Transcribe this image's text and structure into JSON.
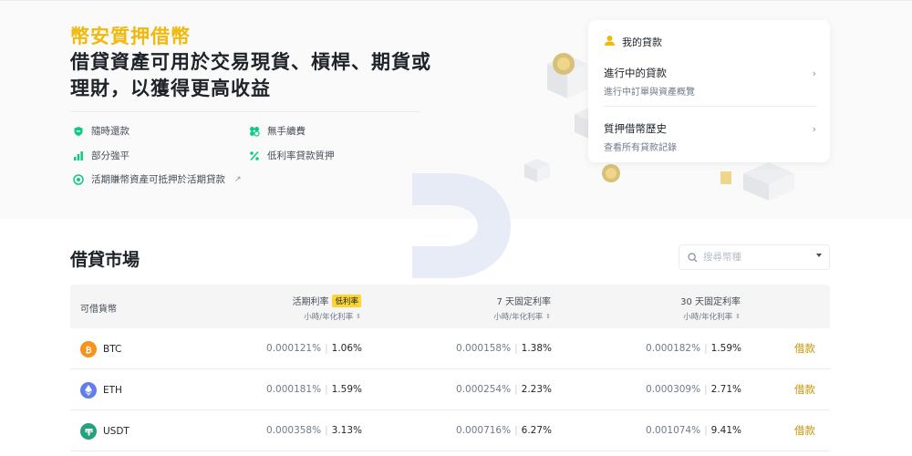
{
  "hero": {
    "brand_title": "幣安質押借幣",
    "headline": "借貸資產可用於交易現貨、槓桿、期貨或理財，以獲得更高收益",
    "features": [
      {
        "icon": "shield-icon",
        "label": "隨時還款"
      },
      {
        "icon": "bars-icon",
        "label": "部分強平"
      },
      {
        "icon": "coins-icon",
        "label": "活期賺幣資產可抵押於活期貸款"
      },
      {
        "icon": "fee-icon",
        "label": "無手續費"
      },
      {
        "icon": "percent-icon",
        "label": "低利率貸款質押"
      }
    ]
  },
  "loan_card": {
    "title": "我的貸款",
    "items": [
      {
        "title": "進行中的貸款",
        "subtitle": "進行中訂單與資產概覽"
      },
      {
        "title": "質押借幣歷史",
        "subtitle": "查看所有貸款記錄"
      }
    ]
  },
  "market": {
    "title": "借貸市場",
    "search_placeholder": "搜尋幣種",
    "columns": {
      "coin": "可借貨幣",
      "flexible": "活期利率",
      "flexible_badge": "低利率",
      "day7": "7 天固定利率",
      "day30": "30 天固定利率",
      "sub": "小時/年化利率"
    },
    "rows": [
      {
        "coin": "BTC",
        "flex_hr": "0.000121%",
        "flex_yr": "1.06%",
        "d7_hr": "0.000158%",
        "d7_yr": "1.38%",
        "d30_hr": "0.000182%",
        "d30_yr": "1.59%",
        "action": "借款"
      },
      {
        "coin": "ETH",
        "flex_hr": "0.000181%",
        "flex_yr": "1.59%",
        "d7_hr": "0.000254%",
        "d7_yr": "2.23%",
        "d30_hr": "0.000309%",
        "d30_yr": "2.71%",
        "action": "借款"
      },
      {
        "coin": "USDT",
        "flex_hr": "0.000358%",
        "flex_yr": "3.13%",
        "d7_hr": "0.000716%",
        "d7_yr": "6.27%",
        "d30_hr": "0.001074%",
        "d30_yr": "9.41%",
        "action": "借款"
      }
    ]
  },
  "colors": {
    "brand": "#f0b90b",
    "accent_text": "#c99400",
    "feature_green": "#0ecb81",
    "btc": "#f7931a",
    "eth": "#627eea",
    "usdt": "#26a17b"
  }
}
